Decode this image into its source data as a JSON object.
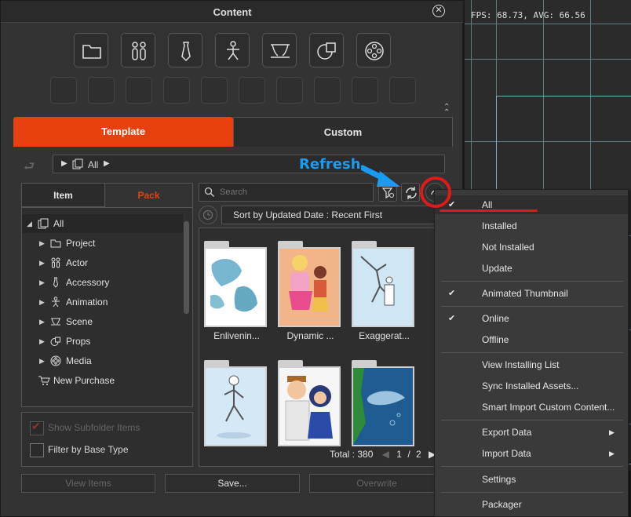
{
  "window": {
    "title": "Content"
  },
  "categories": [
    {
      "icon": "folder-icon"
    },
    {
      "icon": "actor-icon"
    },
    {
      "icon": "accessory-icon"
    },
    {
      "icon": "animation-icon"
    },
    {
      "icon": "scene-icon"
    },
    {
      "icon": "props-icon"
    },
    {
      "icon": "media-icon"
    }
  ],
  "tabs": {
    "template": "Template",
    "custom": "Custom"
  },
  "breadcrumb": {
    "path": "All"
  },
  "subtabs": {
    "item": "Item",
    "pack": "Pack"
  },
  "tree": [
    {
      "label": "All",
      "icon": "all-icon"
    },
    {
      "label": "Project",
      "icon": "folder-icon"
    },
    {
      "label": "Actor",
      "icon": "actor-icon"
    },
    {
      "label": "Accessory",
      "icon": "accessory-icon"
    },
    {
      "label": "Animation",
      "icon": "animation-icon"
    },
    {
      "label": "Scene",
      "icon": "scene-icon"
    },
    {
      "label": "Props",
      "icon": "props-icon"
    },
    {
      "label": "Media",
      "icon": "media-icon"
    },
    {
      "label": "New Purchase",
      "icon": "cart-icon"
    }
  ],
  "options": {
    "show_subfolder": "Show Subfolder Items",
    "filter_base": "Filter by Base Type"
  },
  "search": {
    "placeholder": "Search"
  },
  "sort": {
    "label": "Sort by Updated Date : Recent First"
  },
  "items": [
    {
      "label": "Enlivenin..."
    },
    {
      "label": "Dynamic ..."
    },
    {
      "label": "Exaggerat..."
    }
  ],
  "pager": {
    "total": "Total : 380",
    "page": "1",
    "sep": "/",
    "pages": "2"
  },
  "buttons": {
    "view_items": "View Items",
    "save": "Save...",
    "overwrite": "Overwrite"
  },
  "fps": "FPS: 68.73, AVG: 66.56",
  "annotation": {
    "refresh": "Refresh"
  },
  "menu": [
    {
      "label": "All",
      "checked": false
    },
    {
      "label": "Installed",
      "checked": false
    },
    {
      "label": "Not Installed",
      "checked": false
    },
    {
      "label": "Update",
      "checked": false
    },
    {
      "label": "Animated Thumbnail",
      "checked": true
    },
    {
      "label": "Online",
      "checked": true
    },
    {
      "label": "Offline",
      "checked": false
    },
    {
      "label": "View Installing List",
      "checked": false
    },
    {
      "label": "Sync Installed Assets...",
      "checked": false
    },
    {
      "label": "Smart Import Custom Content...",
      "checked": false
    },
    {
      "label": "Export Data",
      "submenu": true
    },
    {
      "label": "Import Data",
      "submenu": true
    },
    {
      "label": "Settings",
      "checked": false
    },
    {
      "label": "Packager",
      "checked": false
    }
  ],
  "colors": {
    "accent": "#e8400f",
    "annotation_blue": "#1a9bf0",
    "annotation_red": "#e01a1a"
  }
}
